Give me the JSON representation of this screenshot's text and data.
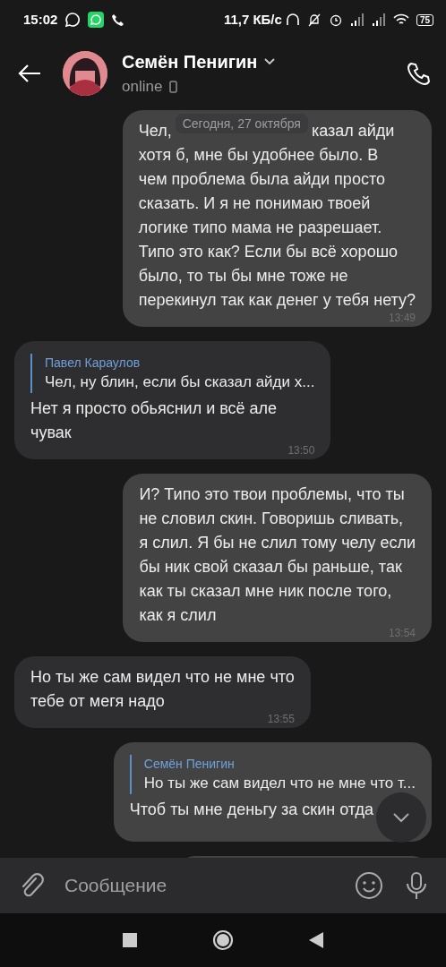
{
  "status_bar": {
    "time": "15:02",
    "speed": "11,7 КБ/с",
    "battery": "75"
  },
  "header": {
    "name": "Семён Пенигин",
    "status": "online"
  },
  "date_label": "Сегодня, 27 октября",
  "messages": [
    {
      "outgoing": true,
      "head_left": "Чел,",
      "head_right": "казал айди",
      "text": "хотя б, мне бы удобнее было. В\nчем проблема была айди просто\nсказать. И я не понимаю твоей\nлогике типо мама не разрешает.\nТипо это как? Если бы всё хорошо\nбыло, то ты бы мне тоже не\nперекинул так как денег у тебя нету?",
      "time": "13:49"
    },
    {
      "outgoing": false,
      "reply": {
        "author": "Павел Караулов",
        "text": "Чел, ну блин, если бы сказал айди х..."
      },
      "text": "Нет я просто обьяснил и всё але\nчувак",
      "time": "13:50"
    },
    {
      "outgoing": true,
      "text": "И? Типо это твои проблемы, что ты\nне словил скин. Говоришь сливать,\nя слил. Я бы не слил тому челу если\nбы ник свой сказал бы раньше, так\nкак ты сказал мне ник после того,\nкак я слил",
      "time": "13:54"
    },
    {
      "outgoing": false,
      "text": "Но ты же сам видел что не мне что\nтебе от мегя надо",
      "time": "13:55"
    },
    {
      "outgoing": true,
      "reply": {
        "author": "Семён Пенигин",
        "text": "Но ты же сам видел что не мне что т..."
      },
      "text": "Чтоб ты мне деньгу за скин отда"
    },
    {
      "outgoing": true
    }
  ],
  "composer": {
    "placeholder": "Сообщение"
  }
}
